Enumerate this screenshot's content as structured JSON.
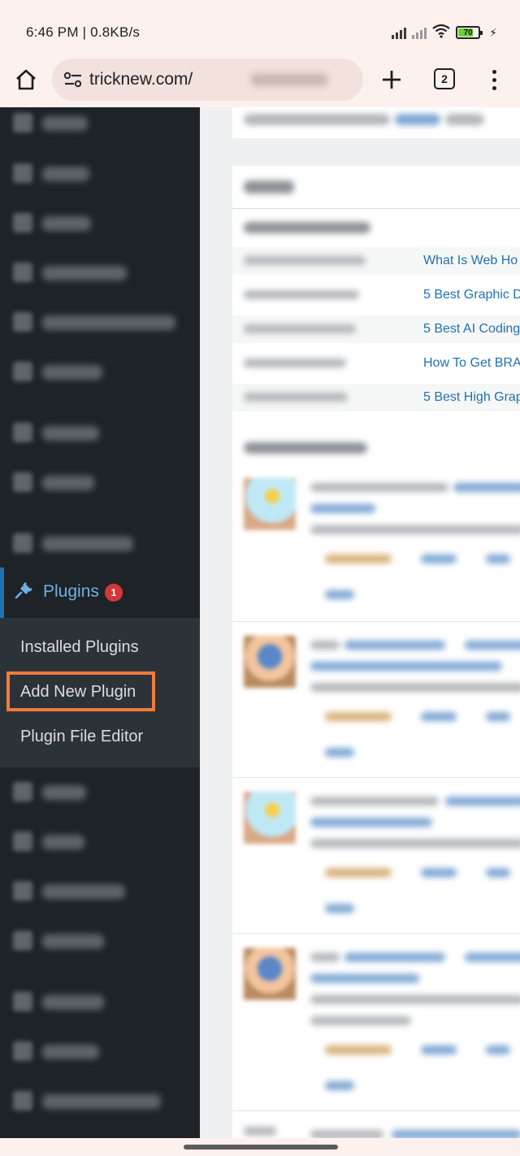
{
  "status_bar": {
    "time_speed": "6:46 PM | 0.8KB/s",
    "battery": "70",
    "icons": [
      "signal-icon",
      "signal-icon",
      "wifi-icon",
      "battery-icon",
      "charging-icon"
    ]
  },
  "browser": {
    "url": "tricknew.com/",
    "tab_count": "2",
    "icons": [
      "home-icon",
      "site-settings-icon",
      "new-tab-icon",
      "tab-switcher-icon",
      "more-menu-icon"
    ]
  },
  "sidebar": {
    "plugins_label": "Plugins",
    "plugins_badge": "1",
    "submenu": [
      {
        "label": "Installed Plugins"
      },
      {
        "label": "Add New Plugin"
      },
      {
        "label": "Plugin File Editor"
      }
    ]
  },
  "dashboard": {
    "recent_posts": [
      "What Is Web Ho",
      "5 Best Graphic D",
      "5 Best AI Coding",
      "How To Get BRA",
      "5 Best High Grap"
    ]
  },
  "colors": {
    "sidebar_bg": "#1d2327",
    "submenu_bg": "#2c3338",
    "wp_blue": "#2271b1",
    "highlight": "#f27a3d",
    "badge_red": "#d63638"
  }
}
